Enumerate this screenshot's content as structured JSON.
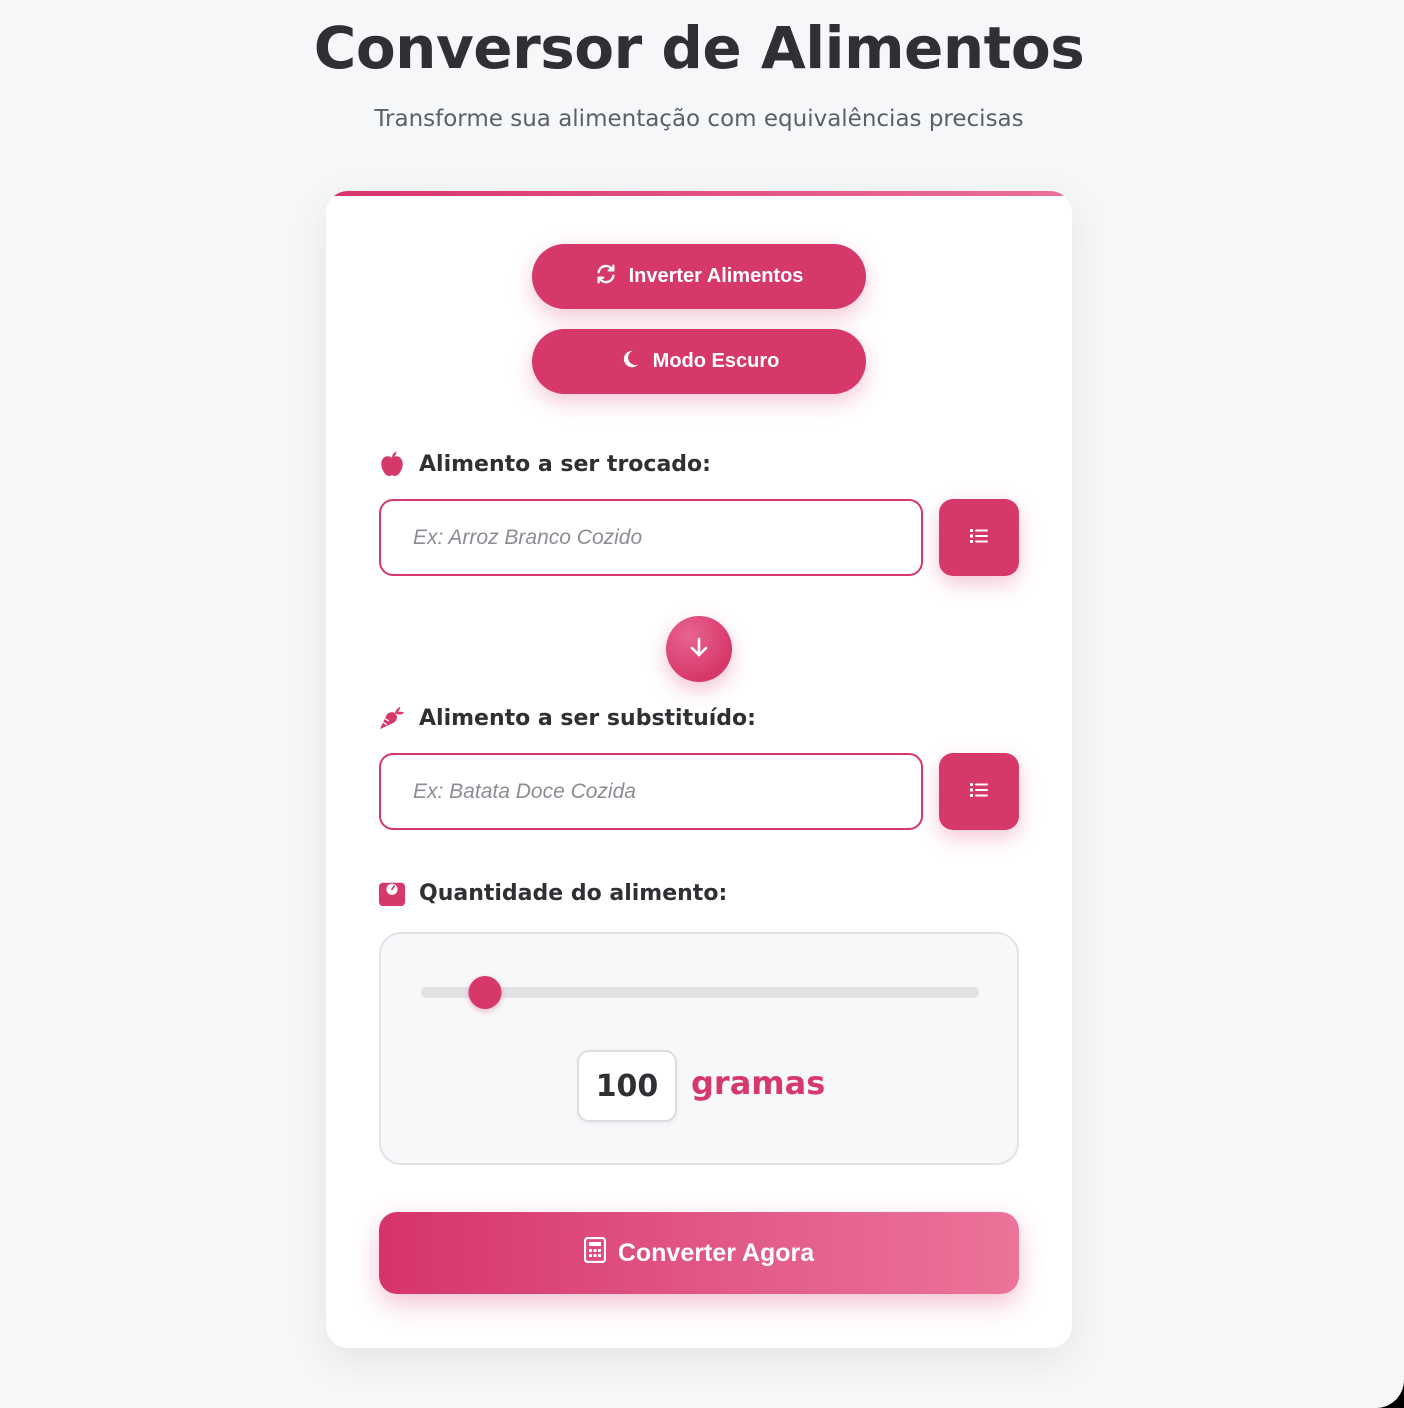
{
  "header": {
    "title": "Conversor de Alimentos",
    "subtitle": "Transforme sua alimentação com equivalências precisas"
  },
  "actions": {
    "invert_label": "Inverter Alimentos",
    "dark_mode_label": "Modo Escuro"
  },
  "from_food": {
    "label": "Alimento a ser trocado:",
    "placeholder": "Ex: Arroz Branco Cozido",
    "value": ""
  },
  "to_food": {
    "label": "Alimento a ser substituído:",
    "placeholder": "Ex: Batata Doce Cozida",
    "value": ""
  },
  "quantity": {
    "label": "Quantidade do alimento:",
    "value": "100",
    "unit": "gramas",
    "slider_fraction": 0.115
  },
  "convert_label": "Converter Agora",
  "colors": {
    "accent": "#d6386a",
    "accent_light": "#ec7399",
    "background": "#f6f7f9",
    "text": "#2f3033"
  },
  "icons": {
    "invert": "sync-icon",
    "dark_mode": "moon-icon",
    "from_food": "apple-icon",
    "to_food": "carrot-icon",
    "quantity": "scale-icon",
    "list": "list-icon",
    "arrow": "arrow-down-icon",
    "convert": "calculator-icon"
  }
}
